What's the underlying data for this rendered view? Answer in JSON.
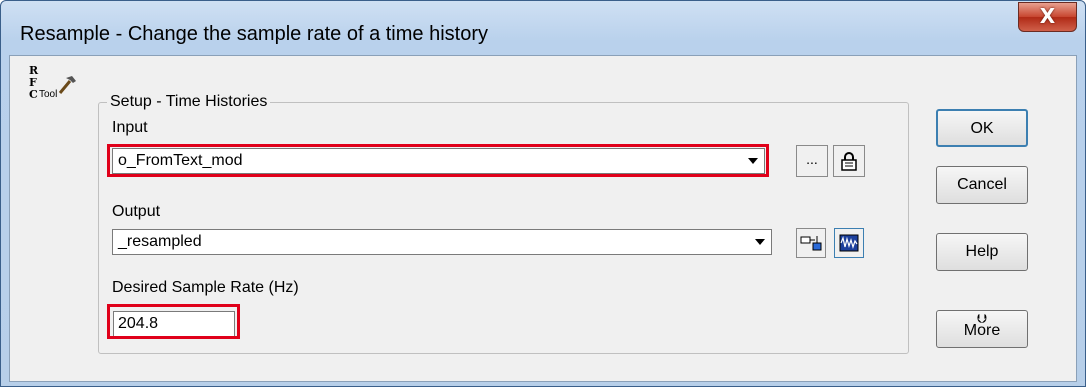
{
  "window": {
    "title": "Resample - Change the sample rate of a time history",
    "close_glyph": "X"
  },
  "logo": {
    "letters": [
      "R",
      "F",
      "C"
    ],
    "tool_text": "Tool",
    "icon": "hammer-icon"
  },
  "setup": {
    "group_label": "Setup - Time Histories",
    "input": {
      "label": "Input",
      "value": "o_FromText_mod",
      "browse_label": "...",
      "lock_icon": "padlock-icon"
    },
    "output": {
      "label": "Output",
      "value": "_resampled",
      "icon_1": "copy-name-icon",
      "icon_2": "waveform-icon"
    },
    "rate": {
      "label": "Desired Sample Rate (Hz)",
      "value": "204.8"
    }
  },
  "buttons": {
    "ok": "OK",
    "cancel": "Cancel",
    "help": "Help",
    "more": "More",
    "more_icon": "double-chevron-down-icon"
  },
  "colors": {
    "highlight": "#e0001a",
    "titlebar": "#b9d1ec",
    "close": "#c7452f"
  }
}
